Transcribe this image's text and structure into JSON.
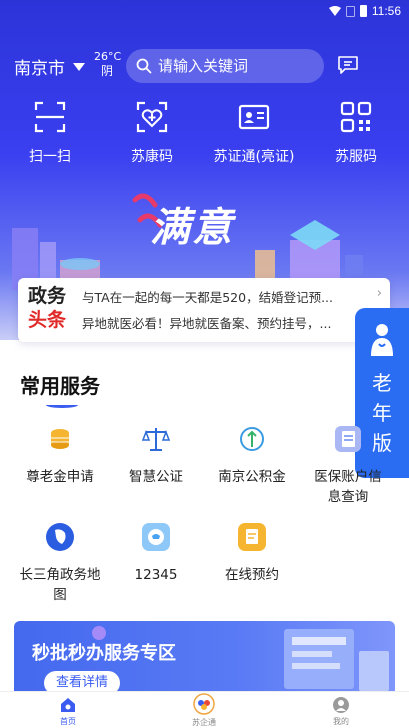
{
  "status_bar": {
    "time": "11:56"
  },
  "header": {
    "city": "南京市",
    "weather_temp": "26°C",
    "weather_desc": "阴",
    "search_placeholder": "请输入关键词"
  },
  "quick_actions": [
    {
      "label": "扫一扫",
      "icon": "scan-icon"
    },
    {
      "label": "苏康码",
      "icon": "health-code-icon"
    },
    {
      "label": "苏证通(亮证)",
      "icon": "id-card-icon"
    },
    {
      "label": "苏服码",
      "icon": "service-code-icon"
    }
  ],
  "banner": {
    "text": "满意"
  },
  "news": {
    "logo_top": "政务",
    "logo_bottom": "头条",
    "items": [
      "与TA在一起的每一天都是520，结婚登记预...",
      "异地就医必看！异地就医备案、预约挂号，..."
    ]
  },
  "elder_mode": {
    "label": "老年版"
  },
  "services": {
    "title": "常用服务",
    "items": [
      {
        "label": "尊老金申请",
        "icon": "coins-icon",
        "color": "#f5b531"
      },
      {
        "label": "智慧公证",
        "icon": "scales-icon",
        "color": "#2b6ad8"
      },
      {
        "label": "南京公积金",
        "icon": "fund-icon",
        "color": "#3a9be0"
      },
      {
        "label": "医保账户信息查询",
        "icon": "insurance-doc-icon",
        "color": "#6a8bf0"
      },
      {
        "label": "长三角政务地图",
        "icon": "map-icon",
        "color": "#2b5de0"
      },
      {
        "label": "12345",
        "icon": "hotline-icon",
        "color": "#4aa3f2"
      },
      {
        "label": "在线预约",
        "icon": "appointment-icon",
        "color": "#f5b531"
      }
    ]
  },
  "promo": {
    "title": "秒批秒办服务专区",
    "button": "查看详情"
  },
  "tabs": [
    {
      "label": "首页",
      "icon": "home-icon",
      "active": true
    },
    {
      "label": "苏企通",
      "icon": "enterprise-icon",
      "active": false
    },
    {
      "label": "我的",
      "icon": "profile-icon",
      "active": false
    }
  ]
}
